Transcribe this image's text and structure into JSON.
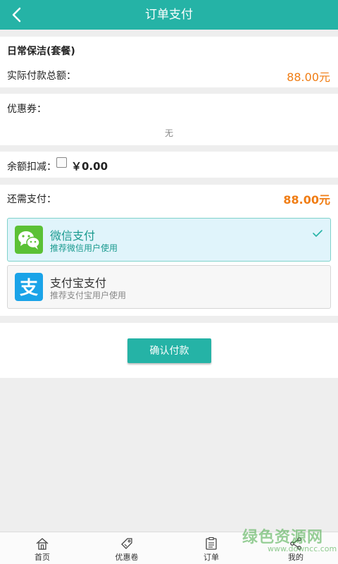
{
  "header": {
    "title": "订单支付",
    "back_icon": "back-arrow-icon"
  },
  "order": {
    "service_name": "日常保洁(套餐)",
    "total_label": "实际付款总额：",
    "total_value": "88.00元"
  },
  "coupon": {
    "label": "优惠券：",
    "value": "无"
  },
  "balance": {
    "label": "余额扣减：",
    "amount": "￥0.00",
    "checked": false
  },
  "remaining": {
    "label": "还需支付：",
    "value": "88.00元"
  },
  "payment_methods": [
    {
      "name": "微信支付",
      "desc": "推荐微信用户使用",
      "icon": "wechat-icon",
      "selected": true,
      "color": "#5bc135"
    },
    {
      "name": "支付宝支付",
      "desc": "推荐支付宝用户使用",
      "icon": "alipay-icon",
      "selected": false,
      "color": "#1aa3e8"
    }
  ],
  "confirm_label": "确认付款",
  "tabbar": [
    {
      "label": "首页",
      "icon": "home-icon"
    },
    {
      "label": "优惠卷",
      "icon": "coupon-tag-icon"
    },
    {
      "label": "订单",
      "icon": "order-list-icon"
    },
    {
      "label": "我的",
      "icon": "share-icon"
    }
  ],
  "watermark": {
    "text": "绿色资源网",
    "url": "www.downcc.com"
  },
  "colors": {
    "primary": "#25b3a6",
    "price": "#f07d14",
    "selected_bg": "#e0f4fb"
  }
}
